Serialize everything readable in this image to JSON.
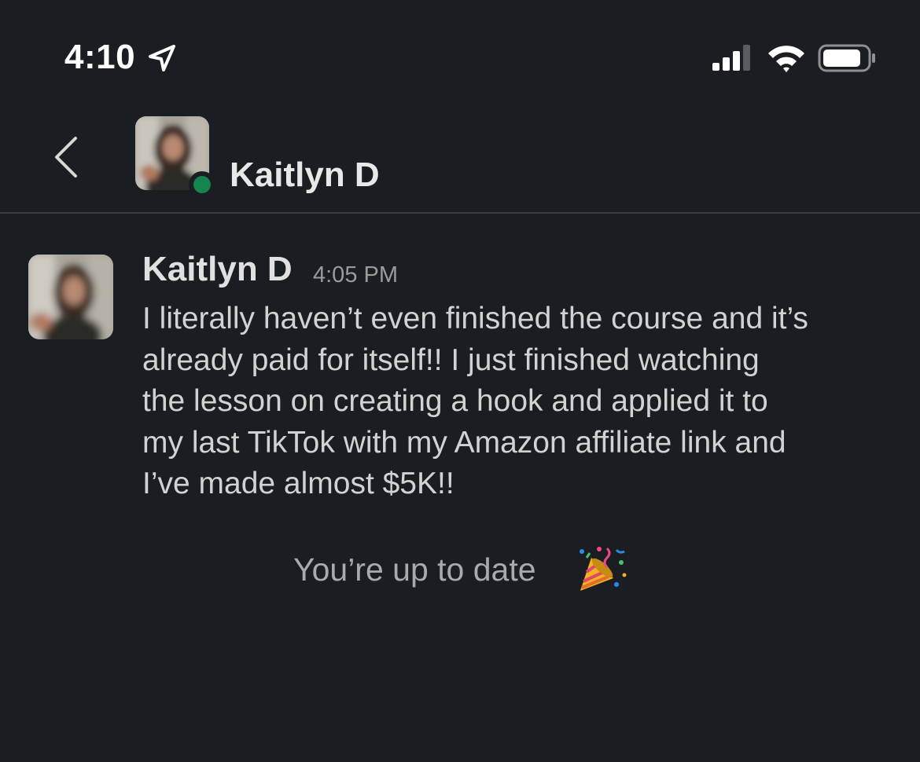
{
  "status_bar": {
    "time": "4:10"
  },
  "header": {
    "contact_name": "Kaitlyn D",
    "presence": "online",
    "presence_color": "#16844f"
  },
  "message": {
    "author": "Kaitlyn D",
    "time": "4:05 PM",
    "lines": [
      "I literally haven’t even finished the course and it’s",
      "already paid for itself!! I just finished watching",
      "the lesson on creating a hook and applied it to",
      "my last TikTok with my Amazon affiliate link and",
      "I’ve made almost $5K!!"
    ]
  },
  "footer": {
    "status_text": "You’re up to date",
    "icon": "party-popper-icon"
  },
  "colors": {
    "background": "#1a1d21",
    "text": "#d1d2d3",
    "muted": "#9a9b9d"
  }
}
